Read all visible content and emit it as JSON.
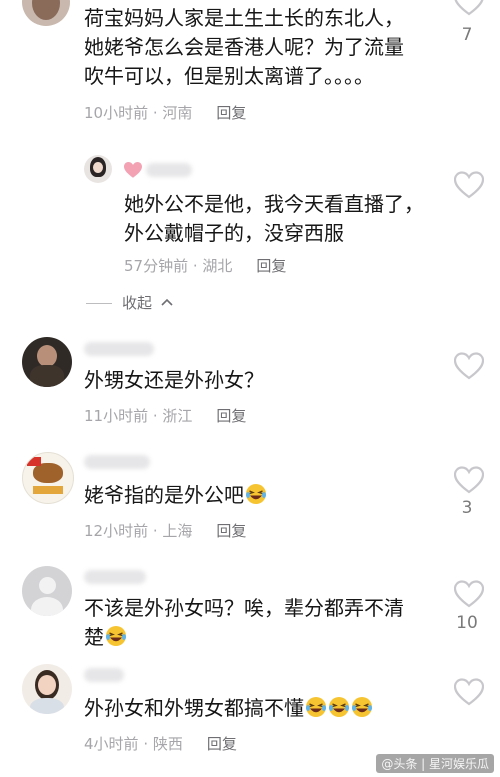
{
  "comments": [
    {
      "text": "荷宝妈妈人家是土生土长的东北人，她姥爷怎么会是香港人呢？为了流量吹牛可以，但是别太离谱了。。。。",
      "time": "10小时前",
      "location": "河南",
      "reply_label": "回复",
      "likes": "7"
    },
    {
      "text": "她外公不是他，我今天看直播了，外公戴帽子的，没穿西服",
      "time": "57分钟前",
      "location": "湖北",
      "reply_label": "回复"
    },
    {
      "text": "外甥女还是外孙女？",
      "time": "11小时前",
      "location": "浙江",
      "reply_label": "回复"
    },
    {
      "text": "姥爷指的是外公吧",
      "time": "12小时前",
      "location": "上海",
      "reply_label": "回复",
      "likes": "3"
    },
    {
      "text": "不该是外孙女吗？唉，辈分都弄不清楚",
      "likes": "10"
    },
    {
      "text": "外孙女和外甥女都搞不懂",
      "time": "4小时前",
      "location": "陕西",
      "reply_label": "回复"
    }
  ],
  "collapse_label": "收起",
  "watermark": "@头条 | 星河娱乐瓜",
  "colors": {
    "heart_stroke": "#c8c8cc",
    "meta_text": "#a6a6aa",
    "emoji_face": "#f6c431"
  },
  "icons": {
    "like": "heart-outline-icon",
    "collapse": "chevron-up-icon",
    "emoji": "laughing-crying-emoji-icon"
  }
}
